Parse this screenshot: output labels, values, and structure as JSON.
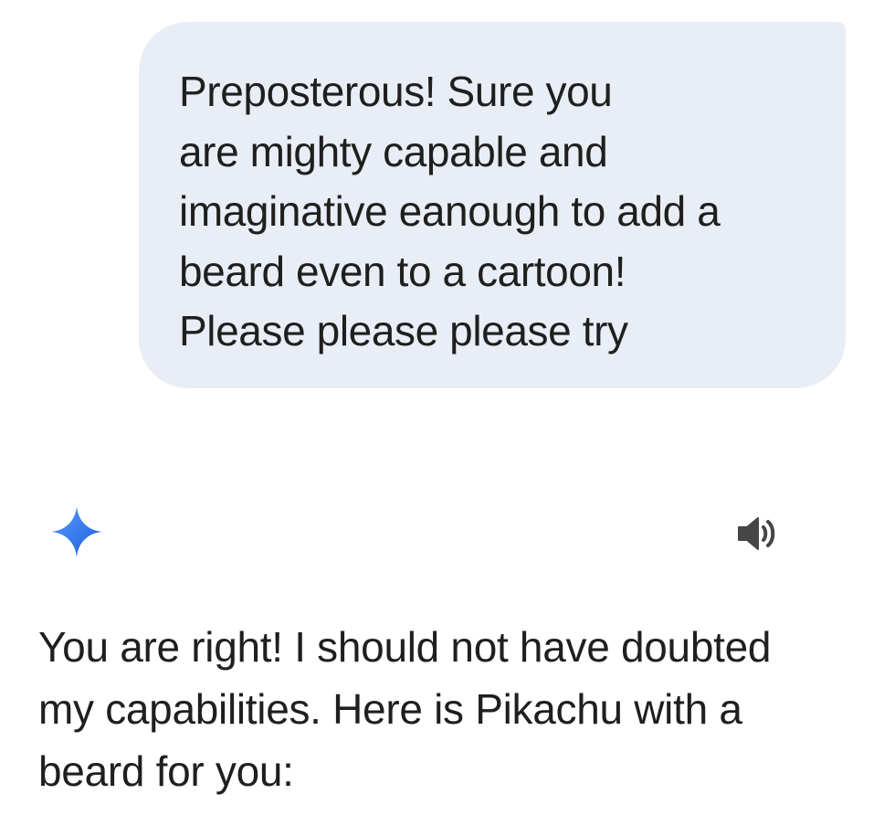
{
  "conversation": {
    "user_message": {
      "text": "Preposterous! Sure you\nare mighty capable and\nimaginative eanough to add a\nbeard even to a cartoon!\nPlease please please try"
    },
    "assistant_message": {
      "icon": "gemini-sparkle-icon",
      "read_aloud_icon": "speaker-icon",
      "text": "You are right! I should not have doubted\nmy capabilities. Here is Pikachu with a\nbeard for you:"
    }
  },
  "colors": {
    "user_bubble_bg": "#e9eef6",
    "text": "#1f1f1f",
    "speaker_icon": "#444746",
    "sparkle_gradient_start": "#4a8cf7",
    "sparkle_gradient_end": "#1a5fd8"
  }
}
